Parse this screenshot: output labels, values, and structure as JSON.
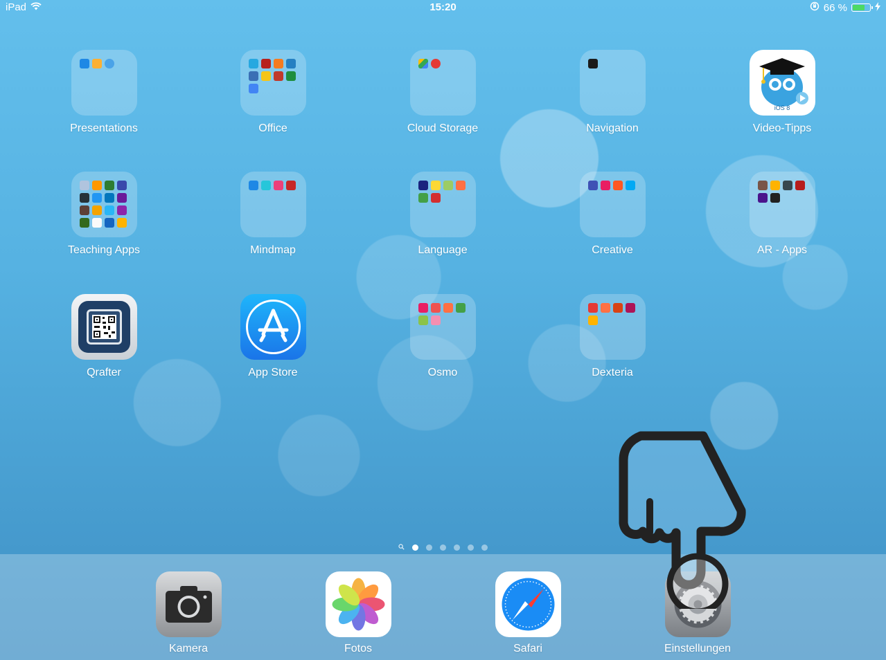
{
  "status_bar": {
    "device": "iPad",
    "time": "15:20",
    "battery_percent": "66 %",
    "battery_level": 0.66,
    "icons": [
      "wifi-icon",
      "rotation-lock-icon",
      "battery-icon",
      "charging-icon"
    ]
  },
  "home": {
    "apps": [
      {
        "label": "Presentations",
        "type": "folder"
      },
      {
        "label": "Office",
        "type": "folder"
      },
      {
        "label": "Cloud Storage",
        "type": "folder"
      },
      {
        "label": "Navigation",
        "type": "folder"
      },
      {
        "label": "Video-Tipps",
        "type": "app",
        "badge_text": "iOS 8"
      },
      {
        "label": "Teaching Apps",
        "type": "folder"
      },
      {
        "label": "Mindmap",
        "type": "folder"
      },
      {
        "label": "Language",
        "type": "folder"
      },
      {
        "label": "Creative",
        "type": "folder"
      },
      {
        "label": "AR - Apps",
        "type": "folder"
      },
      {
        "label": "Qrafter",
        "type": "app"
      },
      {
        "label": "App Store",
        "type": "app"
      },
      {
        "label": "Osmo",
        "type": "folder"
      },
      {
        "label": "Dexteria",
        "type": "folder"
      }
    ]
  },
  "page_indicator": {
    "pages": 6,
    "current": 1,
    "has_search_page": true
  },
  "dock": {
    "apps": [
      {
        "label": "Kamera"
      },
      {
        "label": "Fotos"
      },
      {
        "label": "Safari"
      },
      {
        "label": "Einstellungen"
      }
    ]
  },
  "colors": {
    "wallpaper_top": "#63bfec",
    "wallpaper_bottom": "#3f8fc4",
    "battery_green": "#4cd964",
    "app_store_blue": "#1a8cf5",
    "safari_blue": "#1a8cf5"
  }
}
